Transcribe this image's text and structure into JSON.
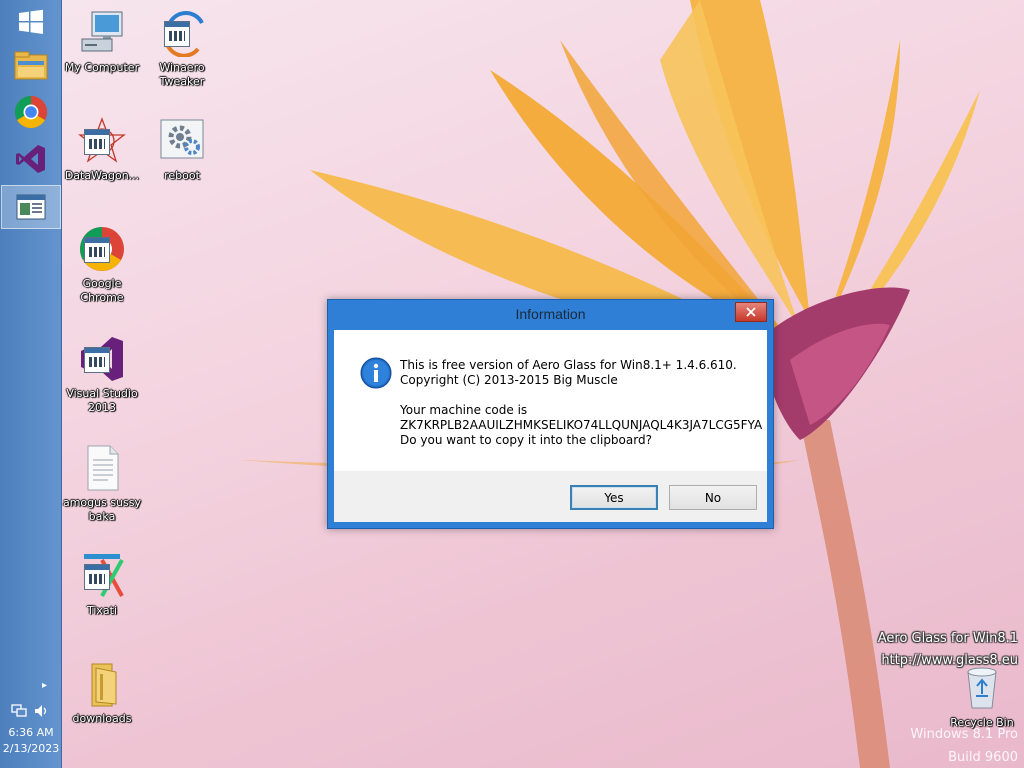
{
  "desktop": {
    "icons": [
      {
        "label": "My Computer"
      },
      {
        "label": "Winaero Tweaker"
      },
      {
        "label": "DataWagon..."
      },
      {
        "label": "reboot"
      },
      {
        "label": "Google Chrome"
      },
      {
        "label": "Visual Studio 2013"
      },
      {
        "label": "amogus sussy baka"
      },
      {
        "label": "Tixati"
      },
      {
        "label": "downloads"
      },
      {
        "label": "Recycle Bin"
      }
    ],
    "watermark": {
      "line1": "Aero Glass for Win8.1",
      "line2": "http://www.glass8.eu",
      "line3": "Windows 8.1 Pro",
      "line4": "Build 9600"
    }
  },
  "taskbar": {
    "pinned": [
      {
        "icon": "windows-start-icon"
      },
      {
        "icon": "file-explorer-icon"
      },
      {
        "icon": "chrome-icon"
      },
      {
        "icon": "visual-studio-icon"
      },
      {
        "icon": "app-window-icon",
        "active": true
      }
    ],
    "clock": {
      "time": "6:36 AM",
      "date": "2/13/2023"
    }
  },
  "dialog": {
    "title": "Information",
    "line1": "This is free version of Aero Glass for Win8.1+ 1.4.6.610.",
    "line2": "Copyright (C) 2013-2015 Big Muscle",
    "line3": "Your machine code is",
    "line4": "ZK7KRPLB2AAUILZHMKSELIKO74LLQUNJAQL4K3JA7LCG5FYA",
    "line5": "Do you want to copy it into the clipboard?",
    "yes_label": "Yes",
    "no_label": "No"
  },
  "colors": {
    "taskbar": "#5a8cc8",
    "dialog_frame": "#2f7fd6",
    "close_button": "#c5392b"
  }
}
